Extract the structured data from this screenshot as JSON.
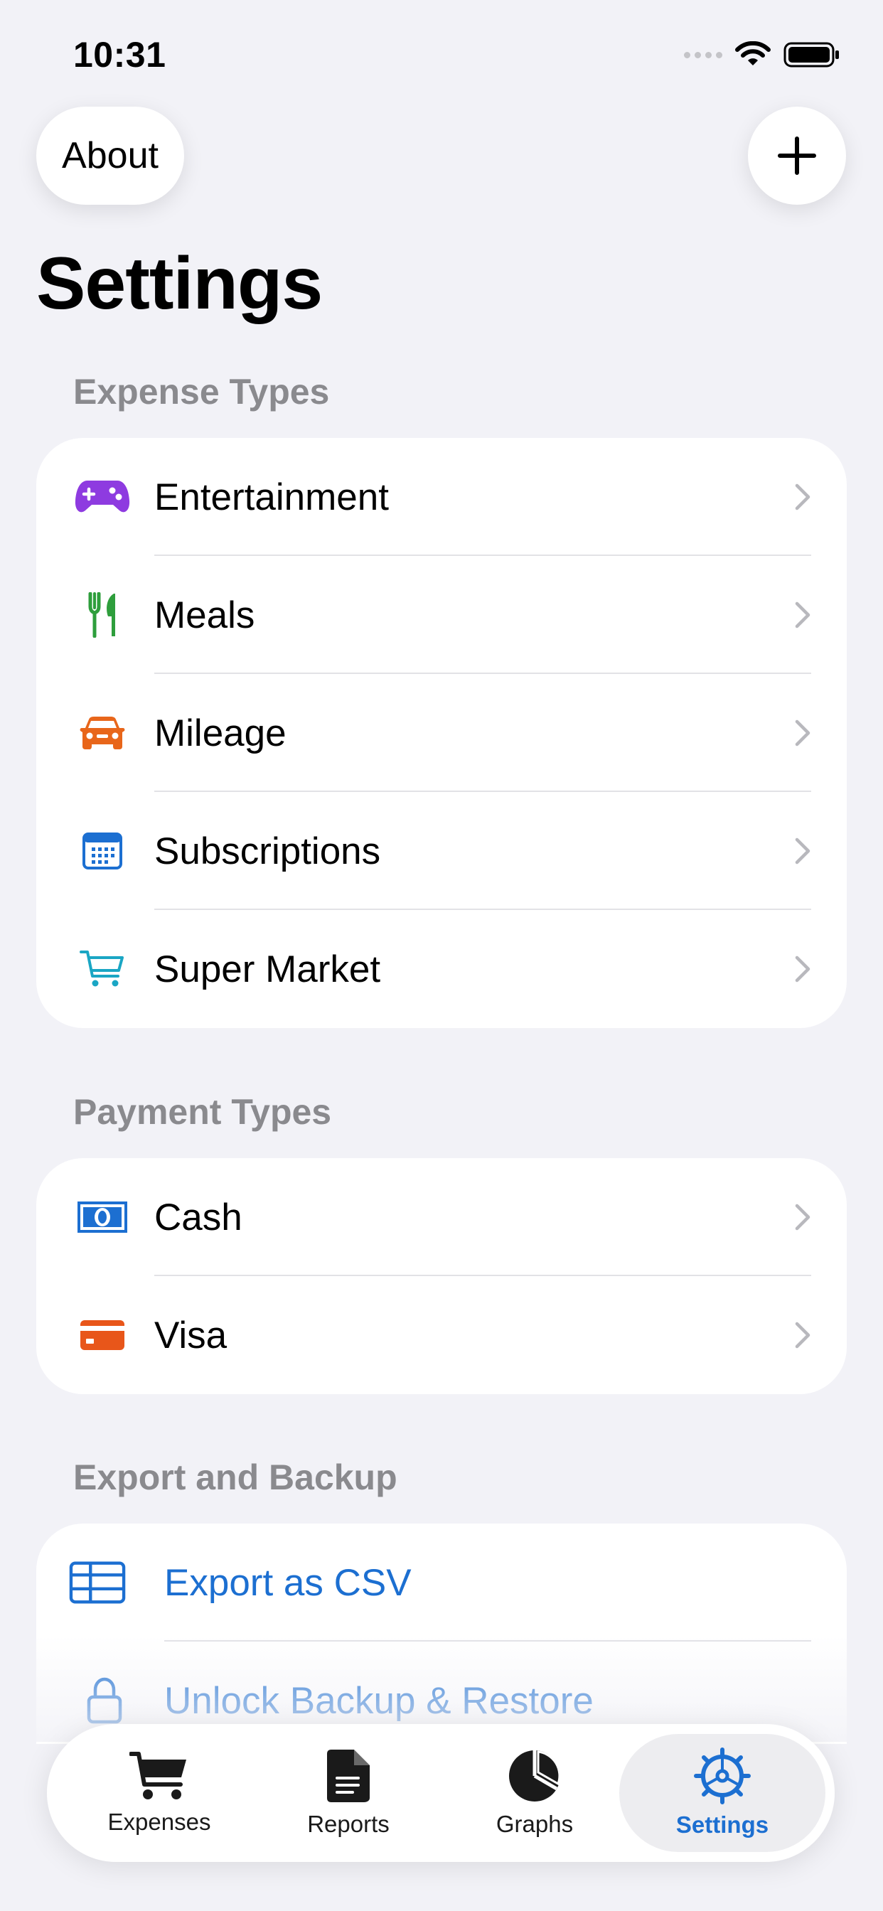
{
  "status_bar": {
    "time": "10:31"
  },
  "nav": {
    "about_label": "About",
    "title": "Settings"
  },
  "sections": {
    "expense_types": {
      "header": "Expense Types",
      "items": [
        {
          "label": "Entertainment",
          "icon": "gamecontroller-icon",
          "color": "#8E3BE0"
        },
        {
          "label": "Meals",
          "icon": "fork-knife-icon",
          "color": "#2E9E3C"
        },
        {
          "label": "Mileage",
          "icon": "car-icon",
          "color": "#E8661A"
        },
        {
          "label": "Subscriptions",
          "icon": "calendar-icon",
          "color": "#1C6FD1"
        },
        {
          "label": "Super Market",
          "icon": "cart-icon",
          "color": "#1AA6C4"
        }
      ]
    },
    "payment_types": {
      "header": "Payment Types",
      "items": [
        {
          "label": "Cash",
          "icon": "banknote-icon",
          "color": "#1C6FD1"
        },
        {
          "label": "Visa",
          "icon": "creditcard-icon",
          "color": "#E8561A"
        }
      ]
    },
    "export_backup": {
      "header": "Export and Backup",
      "items": [
        {
          "label": "Export as CSV",
          "icon": "table-icon"
        },
        {
          "label": "Unlock Backup & Restore",
          "icon": "lock-icon"
        }
      ]
    }
  },
  "tabbar": {
    "tabs": [
      {
        "label": "Expenses",
        "icon": "cart-icon"
      },
      {
        "label": "Reports",
        "icon": "document-icon"
      },
      {
        "label": "Graphs",
        "icon": "chart-pie-icon"
      },
      {
        "label": "Settings",
        "icon": "gear-icon",
        "selected": true
      }
    ]
  },
  "colors": {
    "accent": "#1C6FD1",
    "background": "#F2F2F7",
    "secondary_text": "#8A8A8E"
  }
}
